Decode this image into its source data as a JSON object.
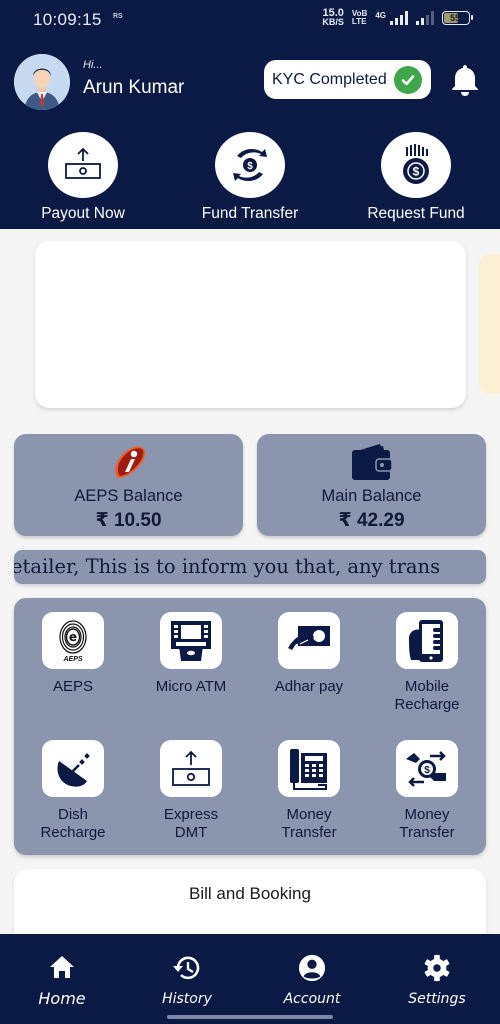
{
  "status_bar": {
    "time": "10:09:15",
    "app_badge": "RS",
    "net_speed_value": "15.0",
    "net_speed_unit": "KB/S",
    "volte_top": "VoB",
    "volte_bottom": "LTE",
    "network_type": "4G",
    "battery_level": "55"
  },
  "header": {
    "greeting": "Hi...",
    "user_name": "Arun Kumar",
    "kyc_label": "KYC Completed",
    "colors": {
      "header_bg": "#0b1a45",
      "kyc_check": "#3da74a"
    }
  },
  "quick_actions": [
    {
      "label": "Payout Now",
      "icon": "payout-icon"
    },
    {
      "label": "Fund Transfer",
      "icon": "fund-transfer-icon"
    },
    {
      "label": "Request Fund",
      "icon": "request-fund-icon"
    }
  ],
  "balances": [
    {
      "title": "AEPS Balance",
      "amount": "₹ 10.50",
      "icon": "icici-logo-icon"
    },
    {
      "title": "Main Balance",
      "amount": "₹ 42.29",
      "icon": "wallet-icon"
    }
  ],
  "notice": {
    "text": "etailer,   This is to inform you that, any trans"
  },
  "services": [
    {
      "label": "AEPS",
      "icon": "aeps-fingerprint-icon"
    },
    {
      "label": "Micro ATM",
      "icon": "atm-icon"
    },
    {
      "label": "Adhar pay",
      "icon": "adhar-pay-icon"
    },
    {
      "label": "Mobile\nRecharge",
      "icon": "mobile-recharge-icon"
    },
    {
      "label": "Dish\nRecharge",
      "icon": "satellite-dish-icon"
    },
    {
      "label": "Express\nDMT",
      "icon": "express-dmt-icon"
    },
    {
      "label": "Money\nTransfer",
      "icon": "telephone-icon"
    },
    {
      "label": "Money\nTransfer",
      "icon": "money-exchange-icon"
    }
  ],
  "bill_section": {
    "title": "Bill and Booking"
  },
  "bottom_nav": [
    {
      "label": "Home",
      "icon": "home-icon",
      "active": true
    },
    {
      "label": "History",
      "icon": "history-icon",
      "active": false
    },
    {
      "label": "Account",
      "icon": "account-icon",
      "active": false
    },
    {
      "label": "Settings",
      "icon": "settings-icon",
      "active": false
    }
  ]
}
